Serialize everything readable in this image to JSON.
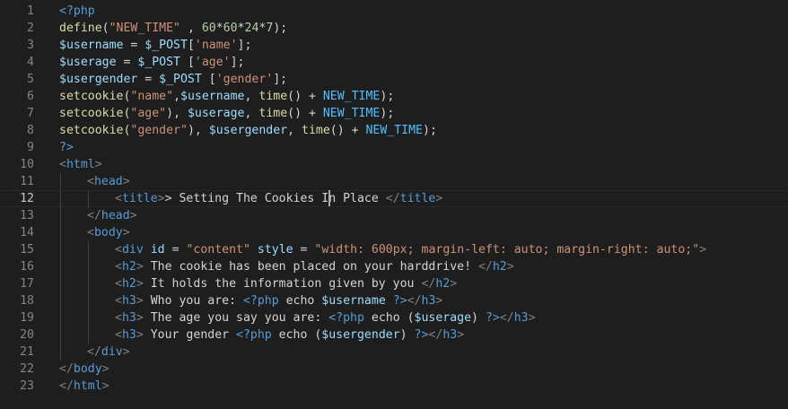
{
  "editor": {
    "current_line": 12,
    "lines": [
      {
        "n": "1",
        "indent": 0,
        "tokens": [
          [
            "k",
            "<?php"
          ]
        ]
      },
      {
        "n": "2",
        "indent": 0,
        "tokens": [
          [
            "f",
            "define"
          ],
          [
            "p",
            "("
          ],
          [
            "s",
            "\"NEW_TIME\""
          ],
          [
            "p",
            " , "
          ],
          [
            "n",
            "60"
          ],
          [
            "p",
            "*"
          ],
          [
            "n",
            "60"
          ],
          [
            "p",
            "*"
          ],
          [
            "n",
            "24"
          ],
          [
            "p",
            "*"
          ],
          [
            "n",
            "7"
          ],
          [
            "p",
            ");"
          ]
        ]
      },
      {
        "n": "3",
        "indent": 0,
        "tokens": [
          [
            "v",
            "$username"
          ],
          [
            "p",
            " = "
          ],
          [
            "v",
            "$_POST"
          ],
          [
            "p",
            "["
          ],
          [
            "s",
            "'name'"
          ],
          [
            "p",
            "];"
          ]
        ]
      },
      {
        "n": "4",
        "indent": 0,
        "tokens": [
          [
            "v",
            "$userage"
          ],
          [
            "p",
            " = "
          ],
          [
            "v",
            "$_POST"
          ],
          [
            "p",
            " ["
          ],
          [
            "s",
            "'age'"
          ],
          [
            "p",
            "];"
          ]
        ]
      },
      {
        "n": "5",
        "indent": 0,
        "tokens": [
          [
            "v",
            "$usergender"
          ],
          [
            "p",
            " = "
          ],
          [
            "v",
            "$_POST"
          ],
          [
            "p",
            " ["
          ],
          [
            "s",
            "'gender'"
          ],
          [
            "p",
            "];"
          ]
        ]
      },
      {
        "n": "6",
        "indent": 0,
        "tokens": [
          [
            "f",
            "setcookie"
          ],
          [
            "p",
            "("
          ],
          [
            "s",
            "\"name\""
          ],
          [
            "p",
            ","
          ],
          [
            "v",
            "$username"
          ],
          [
            "p",
            ", "
          ],
          [
            "f",
            "time"
          ],
          [
            "p",
            "() + "
          ],
          [
            "c",
            "NEW_TIME"
          ],
          [
            "p",
            ");"
          ]
        ]
      },
      {
        "n": "7",
        "indent": 0,
        "tokens": [
          [
            "f",
            "setcookie"
          ],
          [
            "p",
            "("
          ],
          [
            "s",
            "\"age\""
          ],
          [
            "p",
            "), "
          ],
          [
            "v",
            "$userage"
          ],
          [
            "p",
            ", "
          ],
          [
            "f",
            "time"
          ],
          [
            "p",
            "() + "
          ],
          [
            "c",
            "NEW_TIME"
          ],
          [
            "p",
            ");"
          ]
        ]
      },
      {
        "n": "8",
        "indent": 0,
        "tokens": [
          [
            "f",
            "setcookie"
          ],
          [
            "p",
            "("
          ],
          [
            "s",
            "\"gender\""
          ],
          [
            "p",
            "), "
          ],
          [
            "v",
            "$usergender"
          ],
          [
            "p",
            ", "
          ],
          [
            "f",
            "time"
          ],
          [
            "p",
            "() + "
          ],
          [
            "c",
            "NEW_TIME"
          ],
          [
            "p",
            ");"
          ]
        ]
      },
      {
        "n": "9",
        "indent": 0,
        "tokens": [
          [
            "k",
            "?>"
          ]
        ]
      },
      {
        "n": "10",
        "indent": 0,
        "tokens": [
          [
            "t",
            "<"
          ],
          [
            "tn",
            "html"
          ],
          [
            "t",
            ">"
          ]
        ]
      },
      {
        "n": "11",
        "indent": 1,
        "tokens": [
          [
            "t",
            "<"
          ],
          [
            "tn",
            "head"
          ],
          [
            "t",
            ">"
          ]
        ]
      },
      {
        "n": "12",
        "indent": 2,
        "tokens": [
          [
            "t",
            "<"
          ],
          [
            "tn",
            "title"
          ],
          [
            "t",
            ">"
          ],
          [
            "p",
            "> Setting The Cookies In Place "
          ],
          [
            "t",
            "</"
          ],
          [
            "tn",
            "title"
          ],
          [
            "t",
            ">"
          ]
        ]
      },
      {
        "n": "13",
        "indent": 1,
        "tokens": [
          [
            "t",
            "</"
          ],
          [
            "tn",
            "head"
          ],
          [
            "t",
            ">"
          ]
        ]
      },
      {
        "n": "14",
        "indent": 1,
        "tokens": [
          [
            "t",
            "<"
          ],
          [
            "tn",
            "body"
          ],
          [
            "t",
            ">"
          ]
        ]
      },
      {
        "n": "15",
        "indent": 2,
        "tokens": [
          [
            "t",
            "<"
          ],
          [
            "tn",
            "div"
          ],
          [
            "p",
            " "
          ],
          [
            "a",
            "id"
          ],
          [
            "p",
            " = "
          ],
          [
            "s",
            "\"content\""
          ],
          [
            "p",
            " "
          ],
          [
            "a",
            "style"
          ],
          [
            "p",
            " = "
          ],
          [
            "s",
            "\"width: 600px; margin-left: auto; margin-right: auto;\""
          ],
          [
            "t",
            ">"
          ]
        ]
      },
      {
        "n": "16",
        "indent": 2,
        "tokens": [
          [
            "t",
            "<"
          ],
          [
            "tn",
            "h2"
          ],
          [
            "t",
            ">"
          ],
          [
            "p",
            " The cookie has been placed on your harddrive! "
          ],
          [
            "t",
            "</"
          ],
          [
            "tn",
            "h2"
          ],
          [
            "t",
            ">"
          ]
        ]
      },
      {
        "n": "17",
        "indent": 2,
        "tokens": [
          [
            "t",
            "<"
          ],
          [
            "tn",
            "h2"
          ],
          [
            "t",
            ">"
          ],
          [
            "p",
            " It holds the information given by you "
          ],
          [
            "t",
            "</"
          ],
          [
            "tn",
            "h2"
          ],
          [
            "t",
            ">"
          ]
        ]
      },
      {
        "n": "18",
        "indent": 2,
        "tokens": [
          [
            "t",
            "<"
          ],
          [
            "tn",
            "h3"
          ],
          [
            "t",
            ">"
          ],
          [
            "p",
            " Who you are: "
          ],
          [
            "k",
            "<?php"
          ],
          [
            "p",
            " echo "
          ],
          [
            "v",
            "$username"
          ],
          [
            "p",
            " "
          ],
          [
            "k",
            "?>"
          ],
          [
            "t",
            "</"
          ],
          [
            "tn",
            "h3"
          ],
          [
            "t",
            ">"
          ]
        ]
      },
      {
        "n": "19",
        "indent": 2,
        "tokens": [
          [
            "t",
            "<"
          ],
          [
            "tn",
            "h3"
          ],
          [
            "t",
            ">"
          ],
          [
            "p",
            " The age you say you are: "
          ],
          [
            "k",
            "<?php"
          ],
          [
            "p",
            " echo ("
          ],
          [
            "v",
            "$userage"
          ],
          [
            "p",
            ") "
          ],
          [
            "k",
            "?>"
          ],
          [
            "t",
            "</"
          ],
          [
            "tn",
            "h3"
          ],
          [
            "t",
            ">"
          ]
        ]
      },
      {
        "n": "20",
        "indent": 2,
        "tokens": [
          [
            "t",
            "<"
          ],
          [
            "tn",
            "h3"
          ],
          [
            "t",
            ">"
          ],
          [
            "p",
            " Your gender "
          ],
          [
            "k",
            "<?php"
          ],
          [
            "p",
            " echo ("
          ],
          [
            "v",
            "$usergender"
          ],
          [
            "p",
            ") "
          ],
          [
            "k",
            "?>"
          ],
          [
            "t",
            "</"
          ],
          [
            "tn",
            "h3"
          ],
          [
            "t",
            ">"
          ]
        ]
      },
      {
        "n": "21",
        "indent": 1,
        "tokens": [
          [
            "t",
            "</"
          ],
          [
            "tn",
            "div"
          ],
          [
            "t",
            ">"
          ]
        ]
      },
      {
        "n": "22",
        "indent": 0,
        "tokens": [
          [
            "t",
            "</"
          ],
          [
            "tn",
            "body"
          ],
          [
            "t",
            ">"
          ]
        ]
      },
      {
        "n": "23",
        "indent": 0,
        "tokens": [
          [
            "t",
            "</"
          ],
          [
            "tn",
            "html"
          ],
          [
            "t",
            ">"
          ]
        ]
      }
    ]
  }
}
